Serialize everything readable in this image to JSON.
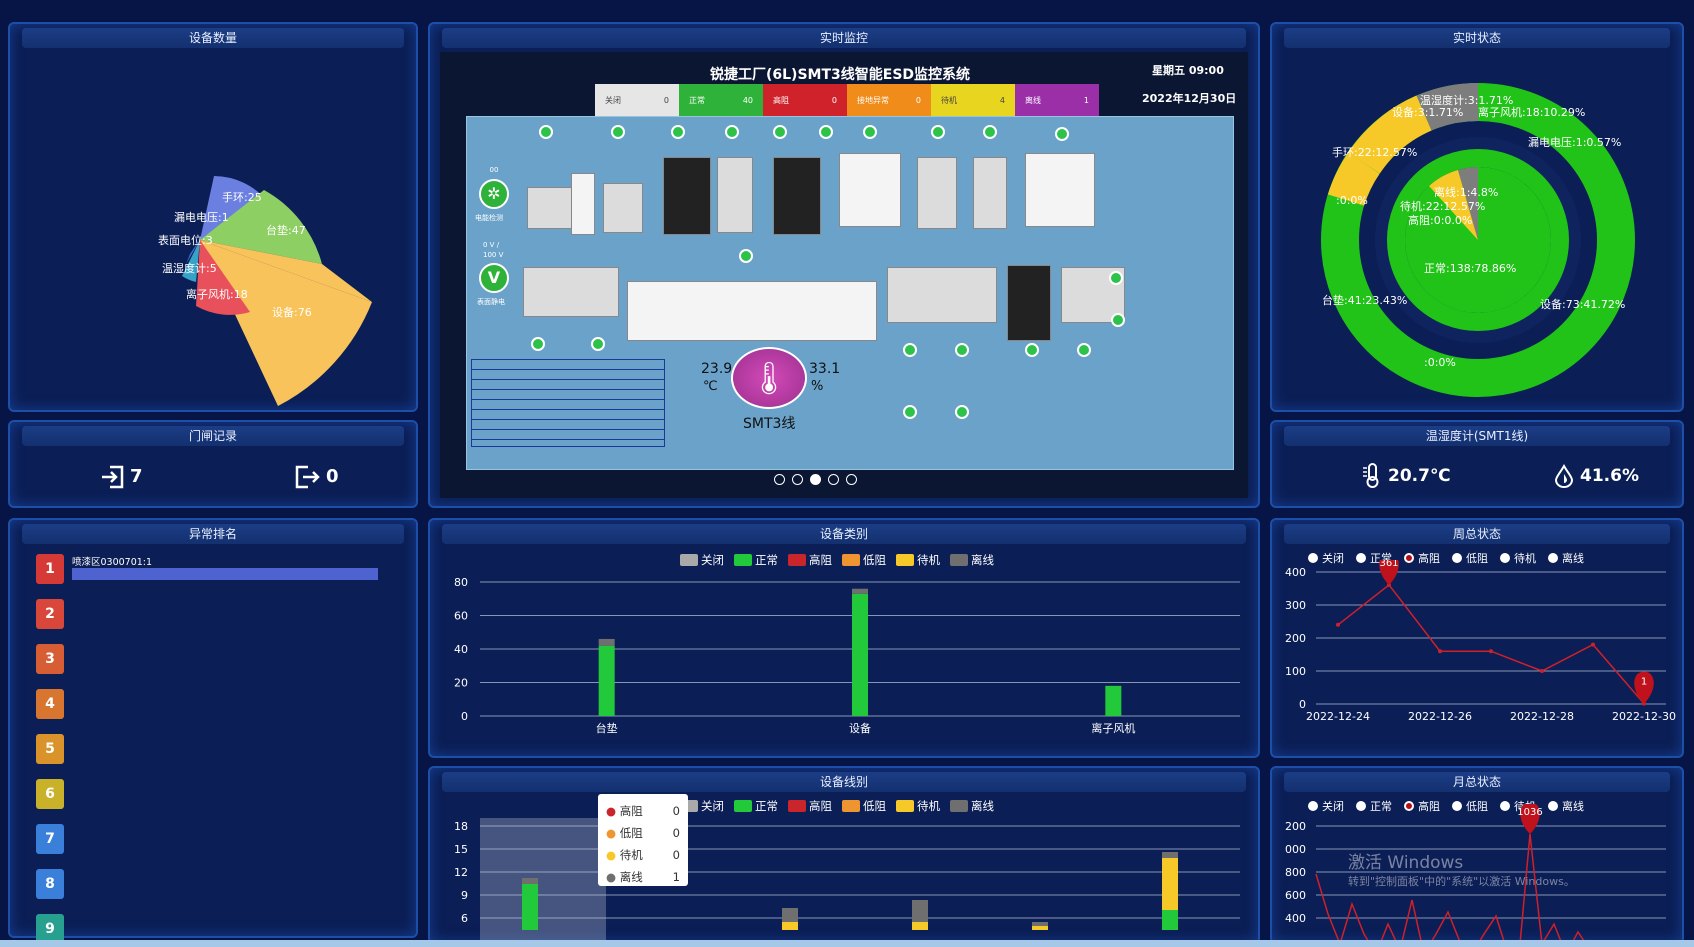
{
  "panels": {
    "device_count": "设备数量",
    "realtime_monitor": "实时监控",
    "realtime_status": "实时状态",
    "door_record": "门闸记录",
    "temp_hum": "温湿度计(SMT1线)",
    "abnormal_rank": "异常排名",
    "device_category": "设备类别",
    "device_line": "设备线别",
    "week_status": "周总状态",
    "month_status": "月总状态"
  },
  "device_count": {
    "labels": [
      "手环:25",
      "漏电电压:1",
      "表面电位:3",
      "温湿度计:5",
      "离子风机:18",
      "台垫:47",
      "设备:76"
    ],
    "colors": [
      "#6b7fe0",
      "#4a90c8",
      "#3a6fd0",
      "#37a2c7",
      "#e8505b",
      "#8ecf64",
      "#f8c35a"
    ]
  },
  "door": {
    "in_count": "7",
    "out_count": "0"
  },
  "monitor": {
    "title": "锐捷工厂(6L)SMT3线智能ESD监控系统",
    "weekday_time": "星期五 09:00",
    "date": "2022年12月30日",
    "status_bar": [
      {
        "label": "关闭",
        "value": "0",
        "color": "#e6e6e6",
        "text": "#444"
      },
      {
        "label": "正常",
        "value": "40",
        "color": "#2fb23a",
        "text": "#fff"
      },
      {
        "label": "高阻",
        "value": "0",
        "color": "#d0222a",
        "text": "#fff"
      },
      {
        "label": "接地异常",
        "value": "0",
        "color": "#f08c1a",
        "text": "#fff"
      },
      {
        "label": "待机",
        "value": "4",
        "color": "#e8d51f",
        "text": "#444"
      },
      {
        "label": "离线",
        "value": "1",
        "color": "#9b2fa8",
        "text": "#fff"
      }
    ],
    "left_labels": [
      "00",
      "电能检测",
      "0 V /",
      "100 V",
      "表面静电"
    ],
    "temp": "23.9",
    "temp_unit": "℃",
    "hum": "33.1",
    "hum_unit": "%",
    "line_name": "SMT3线",
    "pager": 5,
    "pager_active": 2
  },
  "realtime_status": {
    "outer_labels": [
      "温湿度计:3:1.71%",
      "离子风机:18:10.29%",
      "设备:3:1.71%",
      "漏电电压:1:0.57%",
      "手环:22:12.57%",
      ":0:0%",
      "台垫:41:23.43%",
      "设备:73:41.72%",
      ":0:0%"
    ],
    "inner_labels": [
      "离线:1:4.8%",
      "待机:22:12.57%",
      "高阻:0:0.0%",
      "正常:138:78.86%"
    ]
  },
  "temp_hum": {
    "temp": "20.7℃",
    "hum": "41.6%"
  },
  "abnormal": {
    "bar_label": "喷漆区0300701:1",
    "bar_value": 1,
    "ranks": [
      "1",
      "2",
      "3",
      "4",
      "5",
      "6",
      "7",
      "8",
      "9"
    ],
    "rank_colors": [
      "#d63a36",
      "#d8473a",
      "#d75e34",
      "#d8762f",
      "#d9932a",
      "#c9b22a",
      "#3a7fd9",
      "#3a7fd9",
      "#27a08f"
    ]
  },
  "legend": {
    "items": [
      {
        "label": "关闭",
        "color": "#a9a9a9"
      },
      {
        "label": "正常",
        "color": "#22c93a"
      },
      {
        "label": "高阻",
        "color": "#c9252b"
      },
      {
        "label": "低阻",
        "color": "#ee9532"
      },
      {
        "label": "待机",
        "color": "#f6c928"
      },
      {
        "label": "离线",
        "color": "#6f6f6f"
      }
    ]
  },
  "chart_data": [
    {
      "type": "bar",
      "title": "设备类别",
      "categories": [
        "台垫",
        "设备",
        "离子风机"
      ],
      "series": [
        {
          "name": "正常",
          "values": [
            42,
            73,
            18
          ]
        },
        {
          "name": "离线",
          "values": [
            4,
            3,
            0
          ]
        }
      ],
      "ylim": [
        0,
        80
      ],
      "yticks": [
        "0",
        "20",
        "40",
        "60",
        "80"
      ]
    },
    {
      "type": "line",
      "title": "周总状态",
      "x": [
        "2022-12-24",
        "2022-12-25",
        "2022-12-26",
        "2022-12-27",
        "2022-12-28",
        "2022-12-29",
        "2022-12-30"
      ],
      "xticks": [
        "2022-12-24",
        "2022-12-26",
        "2022-12-28",
        "2022-12-30"
      ],
      "series": [
        {
          "name": "高阻",
          "values": [
            240,
            361,
            160,
            160,
            100,
            180,
            1
          ]
        }
      ],
      "ylim": [
        0,
        400
      ],
      "yticks": [
        "0",
        "100",
        "200",
        "300",
        "400"
      ],
      "max_label": "361",
      "min_label": "1"
    },
    {
      "type": "bar",
      "title": "设备线别",
      "yticks": [
        "6",
        "9",
        "12",
        "15",
        "18"
      ],
      "tooltip": [
        {
          "label": "高阻",
          "value": "0",
          "color": "#c9252b"
        },
        {
          "label": "低阻",
          "value": "0",
          "color": "#ee9532"
        },
        {
          "label": "待机",
          "value": "0",
          "color": "#f6c928"
        },
        {
          "label": "离线",
          "value": "1",
          "color": "#6f6f6f"
        }
      ]
    },
    {
      "type": "line",
      "title": "月总状态",
      "yticks": [
        "200",
        "000",
        "800",
        "600",
        "400"
      ],
      "max_label": "1036"
    }
  ],
  "watermark": {
    "line1": "激活 Windows",
    "line2": "转到\"控制面板\"中的\"系统\"以激活 Windows。"
  }
}
